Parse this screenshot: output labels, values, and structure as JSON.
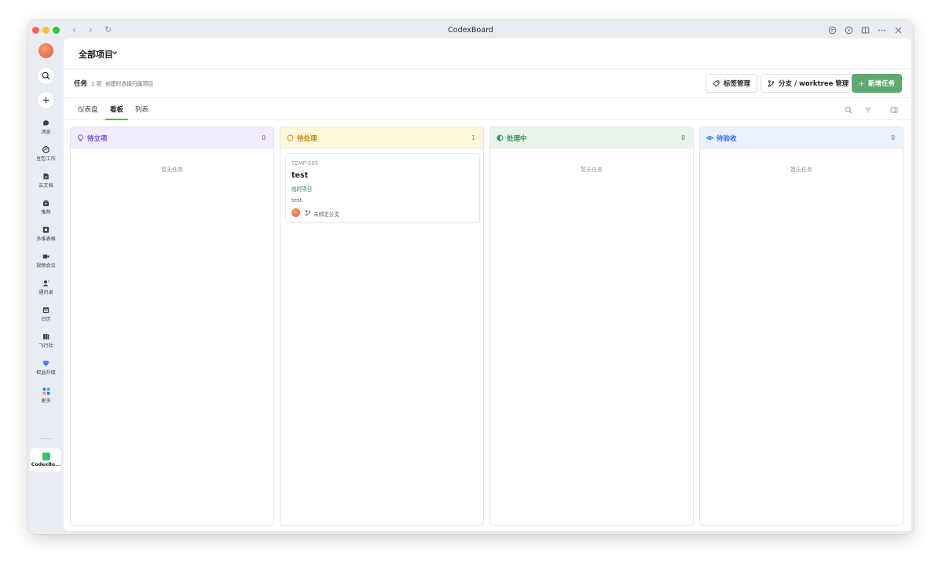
{
  "window": {
    "title": "CodexBoard"
  },
  "titlebar": {
    "nav_back": "‹",
    "nav_forward": "›",
    "reload": "↻",
    "icons": [
      "chat-icon",
      "compass-icon",
      "window-icon",
      "more-icon",
      "close-icon"
    ]
  },
  "sidebar": {
    "items": [
      {
        "label": "消息",
        "icon": "message-icon"
      },
      {
        "label": "豆包工作",
        "icon": "doubao-icon"
      },
      {
        "label": "云文档",
        "icon": "cloud-doc-icon"
      },
      {
        "label": "推荐",
        "icon": "recommend-icon"
      },
      {
        "label": "多维表格",
        "icon": "bitable-icon"
      },
      {
        "label": "视频会议",
        "icon": "video-meeting-icon"
      },
      {
        "label": "通讯录",
        "icon": "contacts-icon"
      },
      {
        "label": "日历",
        "icon": "calendar-icon"
      },
      {
        "label": "飞行社",
        "icon": "flight-club-icon"
      },
      {
        "label": "权益升级",
        "icon": "diamond-icon"
      },
      {
        "label": "更多",
        "icon": "more-apps-icon"
      }
    ],
    "app": {
      "label": "CodexBo...",
      "icon": "codexboard-app-icon"
    }
  },
  "project": {
    "title": "全部项目"
  },
  "taskbar": {
    "title": "任务",
    "count": "1 项",
    "hint": "创建时选择归属项目",
    "tag_button": "标签管理",
    "branch_button": "分支 / worktree 管理",
    "new_button": "新增任务"
  },
  "tabs": [
    {
      "label": "仪表盘",
      "active": false
    },
    {
      "label": "看板",
      "active": true
    },
    {
      "label": "列表",
      "active": false
    }
  ],
  "columns": [
    {
      "title": "待立项",
      "count": "0",
      "color": "#7f3bf5",
      "bg": "#f1ecfc",
      "icon": "bulb-icon",
      "empty": "暂无任务"
    },
    {
      "title": "待处理",
      "count": "1",
      "color": "#c28a00",
      "bg": "#fff6dc",
      "icon": "circle-icon",
      "empty": ""
    },
    {
      "title": "处理中",
      "count": "0",
      "color": "#2e8d4e",
      "bg": "#e8f3ec",
      "icon": "half-circle-icon",
      "empty": "暂无任务"
    },
    {
      "title": "待验收",
      "count": "0",
      "color": "#3370ff",
      "bg": "#eaf0fc",
      "icon": "eye-icon",
      "empty": "暂无任务"
    }
  ],
  "card": {
    "id": "TEMP-005",
    "title": "test",
    "tag": "临时项目",
    "desc": "test",
    "branch": "未绑定分支"
  },
  "colors": {
    "accent": "#5fa86e",
    "tag_green": "#2e8d4e"
  }
}
